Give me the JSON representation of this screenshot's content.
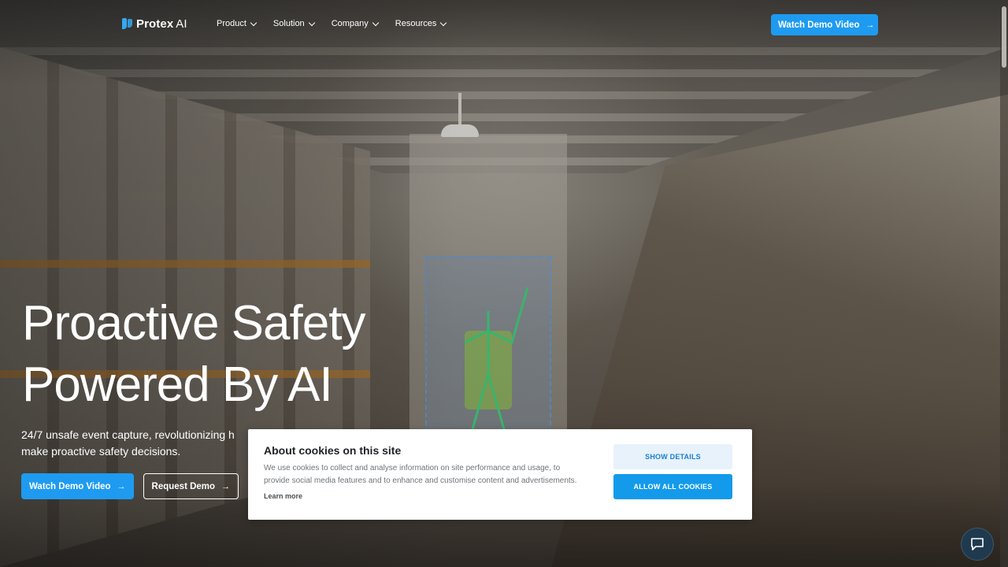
{
  "brand": {
    "name": "Protex",
    "suffix": "AI"
  },
  "nav": {
    "items": [
      {
        "label": "Product"
      },
      {
        "label": "Solution"
      },
      {
        "label": "Company"
      },
      {
        "label": "Resources"
      }
    ],
    "cta_label": "Watch Demo Video"
  },
  "hero": {
    "title_line1": "Proactive Safety",
    "title_line2": "Powered By AI",
    "subtitle": "24/7 unsafe event capture, revolutionizing h",
    "subtitle_line2": "make proactive safety decisions.",
    "primary_button": "Watch Demo Video",
    "secondary_button": "Request Demo"
  },
  "cookie_banner": {
    "title": "About cookies on this site",
    "text": "We use cookies to collect and analyse information on site performance and usage, to provide social media features and to enhance and customise content and advertisements.",
    "learn_more": "Learn more",
    "show_details": "SHOW DETAILS",
    "allow_all": "ALLOW ALL COOKIES"
  },
  "icons": {
    "arrow": "arrow-right-icon",
    "chevron": "chevron-down-icon",
    "chat": "chat-bubble-icon"
  },
  "colors": {
    "accent": "#1e9bf0",
    "cookie_details_bg": "#e7f2fb",
    "chat_bg": "#1f3a4f"
  }
}
